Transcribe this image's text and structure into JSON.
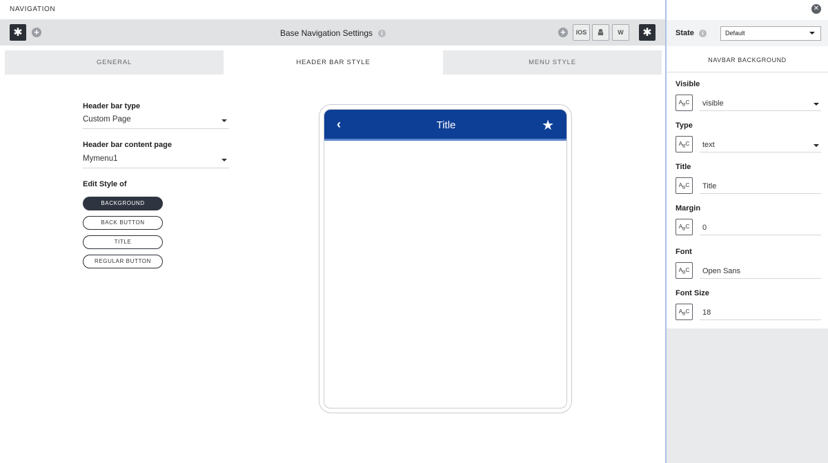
{
  "app": {
    "section_title": "NAVIGATION"
  },
  "toolbar": {
    "title": "Base Navigation Settings",
    "info_icon": "i",
    "left_icon": "asterisk-icon",
    "platforms": [
      "IOS",
      "android-icon",
      "W"
    ]
  },
  "tabs": [
    {
      "label": "GENERAL",
      "active": false
    },
    {
      "label": "HEADER BAR STYLE",
      "active": true
    },
    {
      "label": "MENU STYLE",
      "active": false
    }
  ],
  "form": {
    "header_bar_type_label": "Header bar type",
    "header_bar_type_value": "Custom Page",
    "content_page_label": "Header bar content page",
    "content_page_value": "Mymenu1",
    "edit_style_label": "Edit Style of",
    "style_buttons": [
      "BACKGROUND",
      "BACK BUTTON",
      "TITLE",
      "REGULAR BUTTON"
    ],
    "selected_style": "BACKGROUND"
  },
  "preview": {
    "title": "Title",
    "bar_color": "#0e3f96"
  },
  "panel": {
    "state_label": "State",
    "state_value": "Default",
    "section": "NAVBAR BACKGROUND",
    "abc_icon": "ABC",
    "fields": [
      {
        "label": "Visible",
        "value": "visible",
        "dropdown": true
      },
      {
        "label": "Type",
        "value": "text",
        "dropdown": true
      },
      {
        "label": "Title",
        "value": "Title",
        "dropdown": false
      },
      {
        "label": "Margin",
        "value": "0",
        "dropdown": false
      },
      {
        "label": "Font",
        "value": "Open Sans",
        "dropdown": false
      },
      {
        "label": "Font Size",
        "value": "18",
        "dropdown": false
      }
    ]
  }
}
